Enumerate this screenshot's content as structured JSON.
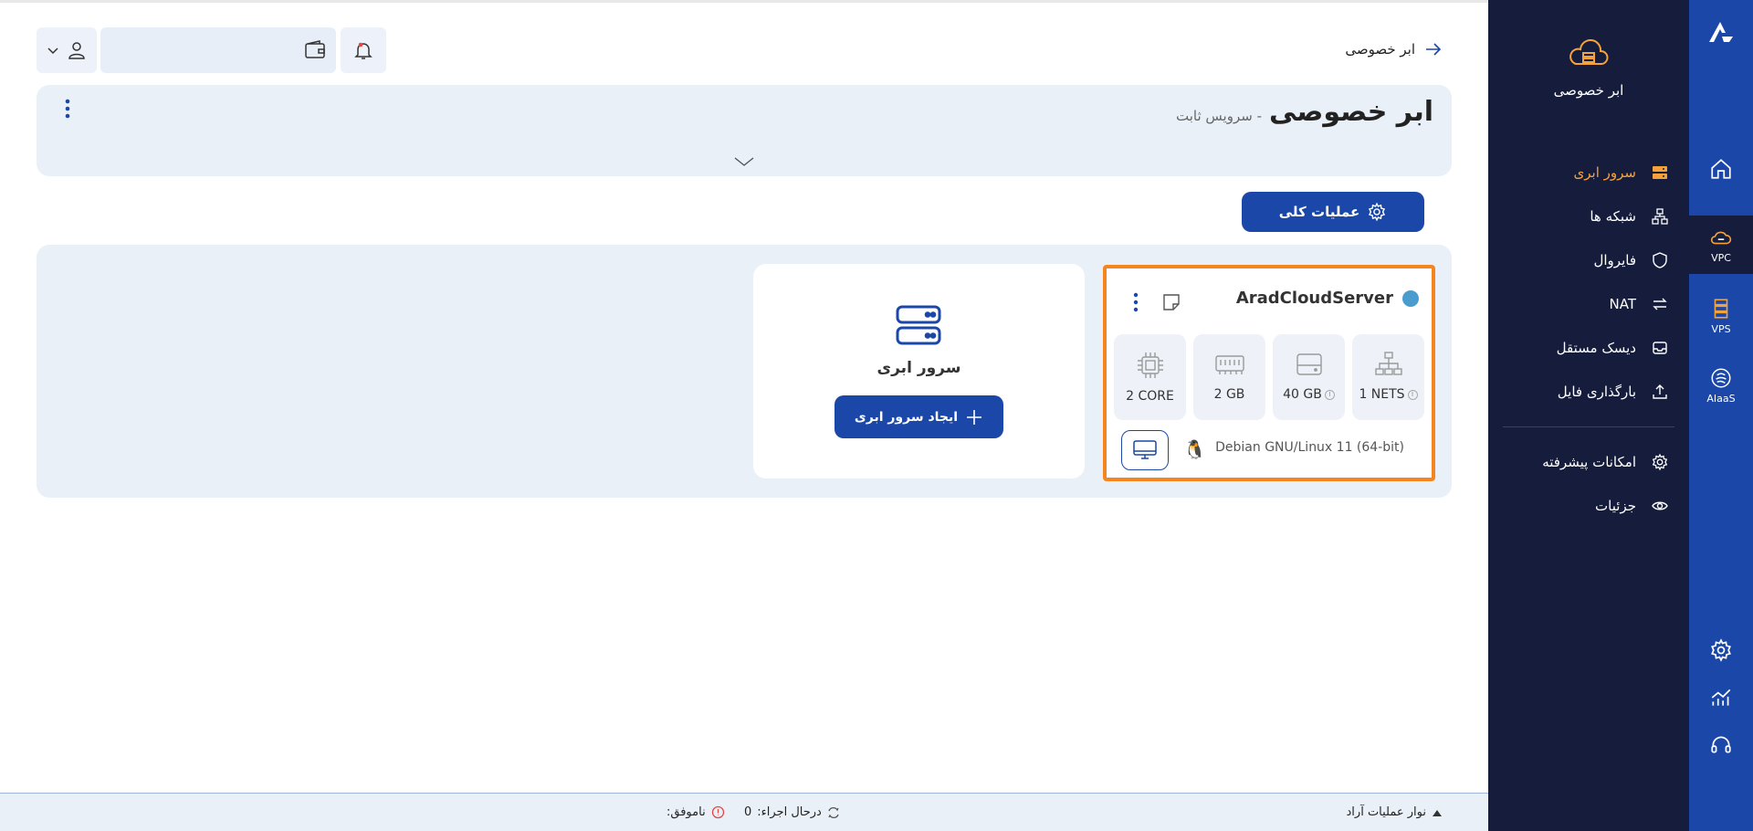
{
  "rail": {
    "items": [
      {
        "label": ""
      },
      {
        "label": "VPC"
      },
      {
        "label": "VPS"
      },
      {
        "label": "AIaaS"
      }
    ]
  },
  "sidebar": {
    "title": "ابر خصوصی",
    "menu": [
      {
        "label": "سرور ابری",
        "active": true
      },
      {
        "label": "شبکه ها"
      },
      {
        "label": "فایروال"
      },
      {
        "label": "NAT"
      },
      {
        "label": "دیسک مستقل"
      },
      {
        "label": "بارگذاری فایل"
      }
    ],
    "menu2": [
      {
        "label": "امکانات پیشرفته"
      },
      {
        "label": "جزئیات"
      }
    ]
  },
  "topbar": {
    "back_label": "ابر خصوصی"
  },
  "header": {
    "title": "ابر خصوصی",
    "subtitle": "- سرویس ثابت"
  },
  "ops_button": "عملیات کلی",
  "server": {
    "name": "AradCloudServer",
    "specs": [
      {
        "value": "1 NETS",
        "info": true
      },
      {
        "value": "40 GB",
        "info": true
      },
      {
        "value": "2 GB",
        "info": false
      },
      {
        "value": "2 CORE",
        "info": false
      }
    ],
    "os": "Debian GNU/Linux 11 (64-bit)"
  },
  "create": {
    "label": "سرور ابری",
    "button": "ایجاد سرور ابری"
  },
  "bottom": {
    "ops_bar": "نوار عملیات آراد",
    "running_label": "درحال اجراء:",
    "running_count": "0",
    "failed_label": "ناموفق:"
  },
  "colors": {
    "primary": "#1a47a8",
    "sidebar": "#151c3c",
    "accent": "#f5a23b",
    "highlight": "#f5851f"
  }
}
